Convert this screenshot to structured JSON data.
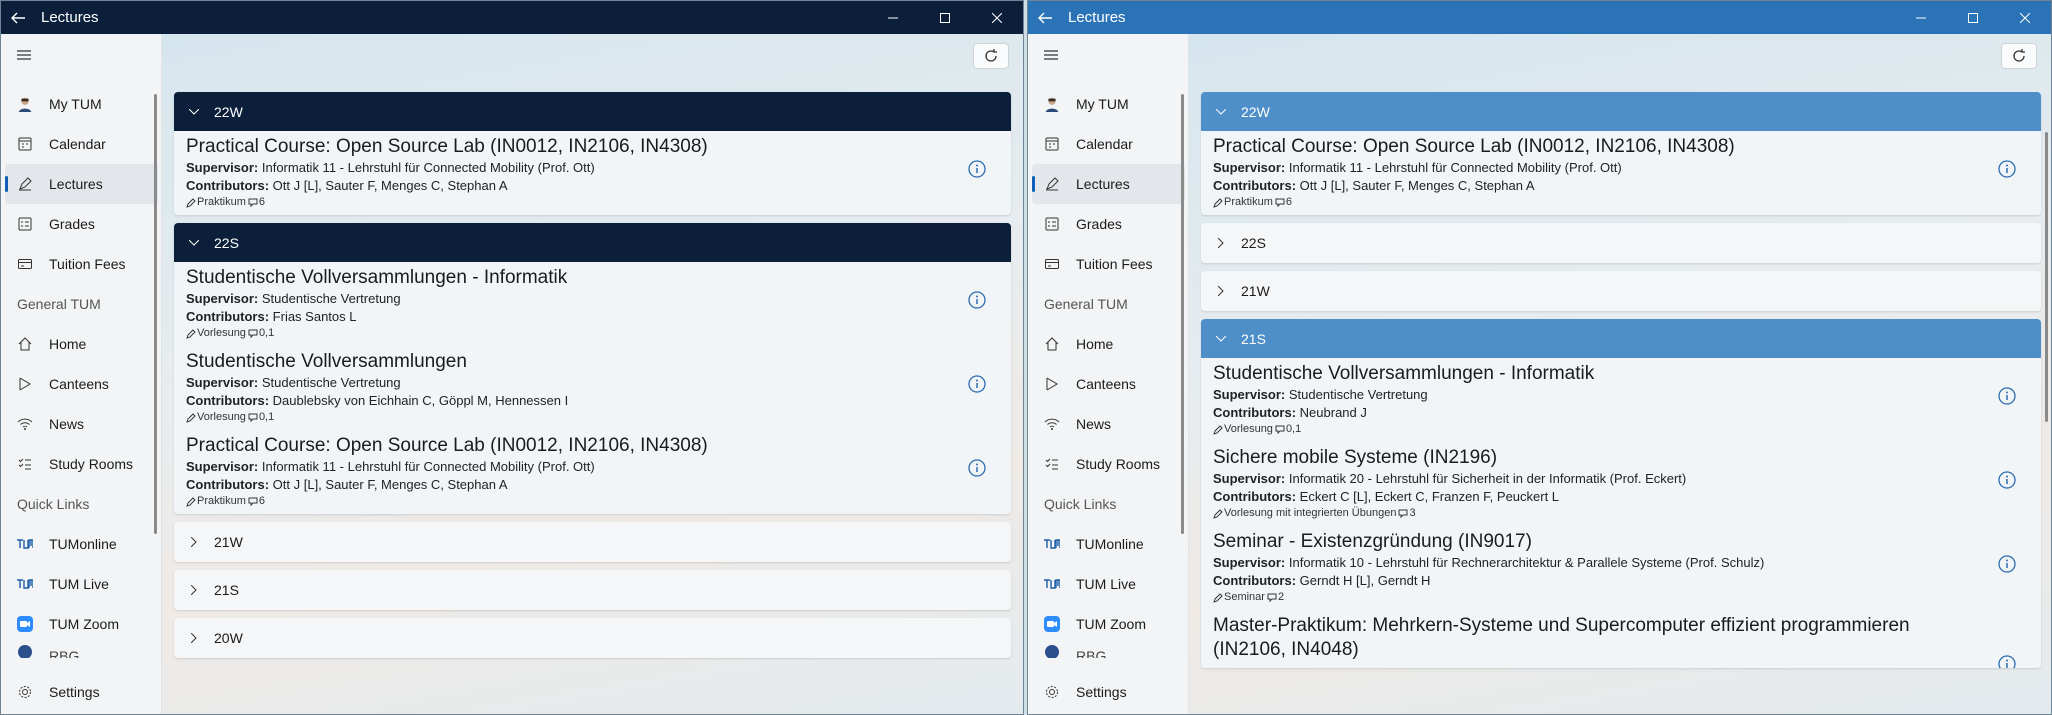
{
  "colors": {
    "win1_title": "#0b1f3b",
    "win2_title": "#2a73b6",
    "accent": "#0e5fb5"
  },
  "windows": [
    {
      "title": "Lectures",
      "nav": {
        "my_tum": "My TUM",
        "calendar": "Calendar",
        "lectures": "Lectures",
        "grades": "Grades",
        "tuition": "Tuition Fees",
        "general_head": "General TUM",
        "home": "Home",
        "canteens": "Canteens",
        "news": "News",
        "study_rooms": "Study Rooms",
        "quick_head": "Quick Links",
        "tumonline": "TUMonline",
        "tumlive": "TUM Live",
        "tumzoom": "TUM Zoom",
        "rbg": "RBG",
        "settings": "Settings"
      },
      "groups": [
        {
          "label": "22W",
          "courses": [
            {
              "title": "Practical Course: Open Source Lab (IN0012, IN2106, IN4308)",
              "sup_label": "Supervisor:",
              "supervisor": "Informatik 11 - Lehrstuhl für Connected Mobility (Prof. Ott)",
              "con_label": "Contributors:",
              "contributors": "Ott J [L], Sauter F, Menges C, Stephan A",
              "type": "Praktikum",
              "sws": "6"
            }
          ]
        },
        {
          "label": "22S",
          "courses": [
            {
              "title": "Studentische Vollversammlungen - Informatik",
              "sup_label": "Supervisor:",
              "supervisor": "Studentische Vertretung",
              "con_label": "Contributors:",
              "contributors": "Frias Santos L",
              "type": "Vorlesung",
              "sws": "0,1"
            },
            {
              "title": "Studentische Vollversammlungen",
              "sup_label": "Supervisor:",
              "supervisor": "Studentische Vertretung",
              "con_label": "Contributors:",
              "contributors": "Daublebsky von Eichhain C, Göppl M, Hennessen I",
              "type": "Vorlesung",
              "sws": "0,1"
            },
            {
              "title": "Practical Course: Open Source Lab (IN0012, IN2106, IN4308)",
              "sup_label": "Supervisor:",
              "supervisor": "Informatik 11 - Lehrstuhl für Connected Mobility (Prof. Ott)",
              "con_label": "Contributors:",
              "contributors": "Ott J [L], Sauter F, Menges C, Stephan A",
              "type": "Praktikum",
              "sws": "6"
            }
          ]
        },
        {
          "label": "21W"
        },
        {
          "label": "21S"
        },
        {
          "label": "20W"
        }
      ]
    },
    {
      "title": "Lectures",
      "nav": {
        "my_tum": "My TUM",
        "calendar": "Calendar",
        "lectures": "Lectures",
        "grades": "Grades",
        "tuition": "Tuition Fees",
        "general_head": "General TUM",
        "home": "Home",
        "canteens": "Canteens",
        "news": "News",
        "study_rooms": "Study Rooms",
        "quick_head": "Quick Links",
        "tumonline": "TUMonline",
        "tumlive": "TUM Live",
        "tumzoom": "TUM Zoom",
        "rbg": "RBG",
        "settings": "Settings"
      },
      "groups": [
        {
          "label": "22W",
          "courses": [
            {
              "title": "Practical Course: Open Source Lab (IN0012, IN2106, IN4308)",
              "sup_label": "Supervisor:",
              "supervisor": "Informatik 11 - Lehrstuhl für Connected Mobility (Prof. Ott)",
              "con_label": "Contributors:",
              "contributors": "Ott J [L], Sauter F, Menges C, Stephan A",
              "type": "Praktikum",
              "sws": "6"
            }
          ]
        },
        {
          "label": "22S"
        },
        {
          "label": "21W"
        },
        {
          "label": "21S",
          "courses": [
            {
              "title": "Studentische Vollversammlungen - Informatik",
              "sup_label": "Supervisor:",
              "supervisor": "Studentische Vertretung",
              "con_label": "Contributors:",
              "contributors": "Neubrand J",
              "type": "Vorlesung",
              "sws": "0,1"
            },
            {
              "title": "Sichere mobile Systeme (IN2196)",
              "sup_label": "Supervisor:",
              "supervisor": "Informatik 20 - Lehrstuhl für Sicherheit in der Informatik (Prof. Eckert)",
              "con_label": "Contributors:",
              "contributors": "Eckert C [L], Eckert C, Franzen F, Peuckert L",
              "type": "Vorlesung mit integrierten Übungen",
              "sws": "3"
            },
            {
              "title": "Seminar - Existenzgründung (IN9017)",
              "sup_label": "Supervisor:",
              "supervisor": "Informatik 10 - Lehrstuhl für Rechnerarchitektur & Parallele Systeme (Prof. Schulz)",
              "con_label": "Contributors:",
              "contributors": "Gerndt H [L], Gerndt H",
              "type": "Seminar",
              "sws": "2"
            },
            {
              "title": "Master-Praktikum: Mehrkern-Systeme und Supercomputer effizient programmieren (IN2106, IN4048)"
            }
          ]
        }
      ]
    }
  ]
}
